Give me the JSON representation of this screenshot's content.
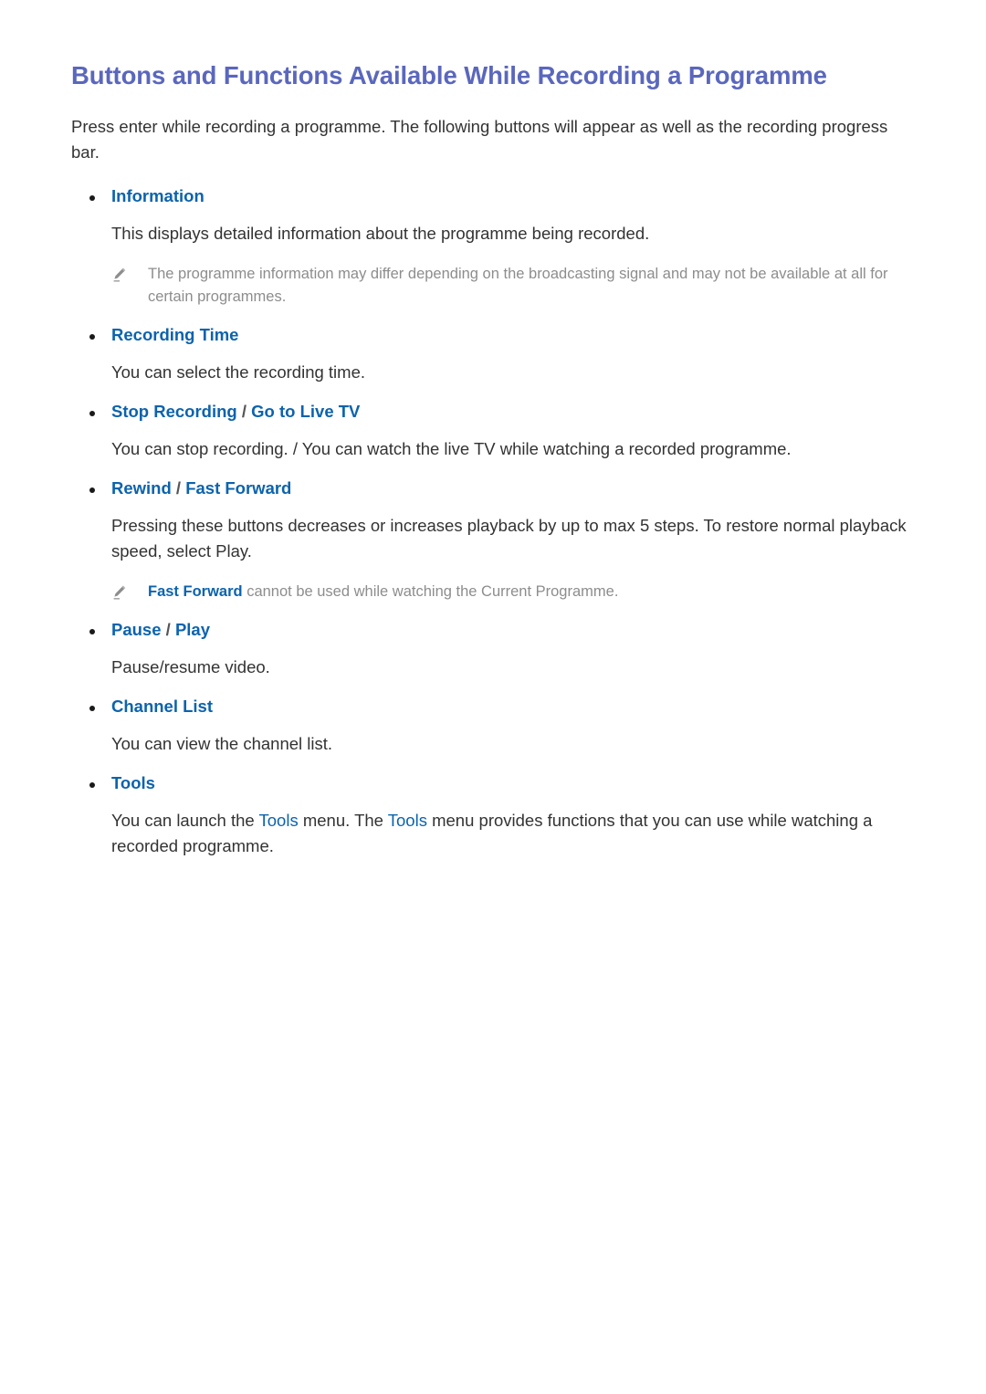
{
  "page": {
    "title": "Buttons and Functions Available While Recording a Programme",
    "intro": "Press enter while recording a programme. The following buttons will appear as well as the recording progress bar."
  },
  "colors": {
    "title_purple": "#5a67bd",
    "heading_blue": "#0c63ad",
    "body_text": "#333333",
    "note_gray": "#8d8d8d",
    "bullet_dot": "#1a1a1a",
    "background": "#ffffff"
  },
  "sections": [
    {
      "heading": "Information",
      "heading_parts": [],
      "body": "This displays detailed information about the programme being recorded.",
      "notes": [
        {
          "icon": "pencil-note-icon",
          "lead_term": "",
          "text": "The programme information may differ depending on the broadcasting signal and may not be available at all for certain programmes."
        }
      ]
    },
    {
      "heading": "Recording Time",
      "heading_parts": [],
      "body": "You can select the recording time.",
      "notes": []
    },
    {
      "heading": "",
      "heading_parts": [
        "Stop Recording",
        " / ",
        "Go to Live TV"
      ],
      "body": "You can stop recording. / You can watch the live TV while watching a recorded programme.",
      "notes": []
    },
    {
      "heading": "",
      "heading_parts": [
        "Rewind",
        " / ",
        "Fast Forward"
      ],
      "body": "Pressing these buttons decreases or increases playback by up to max 5 steps. To restore normal playback speed, select Play.",
      "notes": [
        {
          "icon": "pencil-note-icon",
          "lead_term": "Fast Forward",
          "text": " cannot be used while watching the Current Programme."
        }
      ]
    },
    {
      "heading": "",
      "heading_parts": [
        "Pause",
        " / ",
        "Play"
      ],
      "body": "Pause/resume video.",
      "notes": []
    },
    {
      "heading": "Channel List",
      "heading_parts": [],
      "body": "You can view the channel list.",
      "notes": []
    },
    {
      "heading": "Tools",
      "heading_parts": [],
      "body_rich": {
        "part1": "You can launch the ",
        "term1": "Tools",
        "part2": " menu. The ",
        "term2": "Tools",
        "part3": " menu provides functions that you can use while watching a recorded programme."
      },
      "notes": []
    }
  ]
}
